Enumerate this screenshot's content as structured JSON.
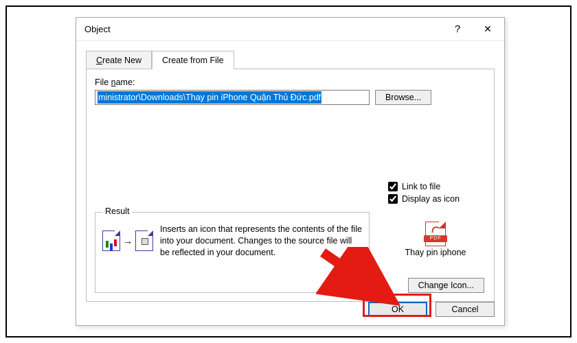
{
  "dialog": {
    "title": "Object",
    "help_tooltip": "?",
    "close_tooltip": "✕"
  },
  "tabs": {
    "create_new_pre": "C",
    "create_new_rest": "reate New",
    "create_from_file_label": "Create from File"
  },
  "body": {
    "file_name_label_pre": "File ",
    "file_name_label_u": "n",
    "file_name_label_post": "ame:",
    "file_name_value": "ministrator\\Downloads\\Thay pin iPhone Quận Thủ Đức.pdf",
    "browse_pre": "B",
    "browse_rest": "rowse...",
    "link_to_file_pre": "Lin",
    "link_to_file_u": "k",
    "link_to_file_post": " to file",
    "display_as_icon_pre": "Displ",
    "display_as_icon_u": "a",
    "display_as_icon_post": "y as icon",
    "preview_caption": "Thay pin iphone",
    "pdf_badge": "PDF",
    "result_legend": "Result",
    "result_text": "Inserts an icon that represents the contents of the file into your document.  Changes to the source file will be reflected in your document.",
    "change_icon_pre": "Change ",
    "change_icon_u": "I",
    "change_icon_post": "con..."
  },
  "footer": {
    "ok": "OK",
    "cancel": "Cancel"
  }
}
